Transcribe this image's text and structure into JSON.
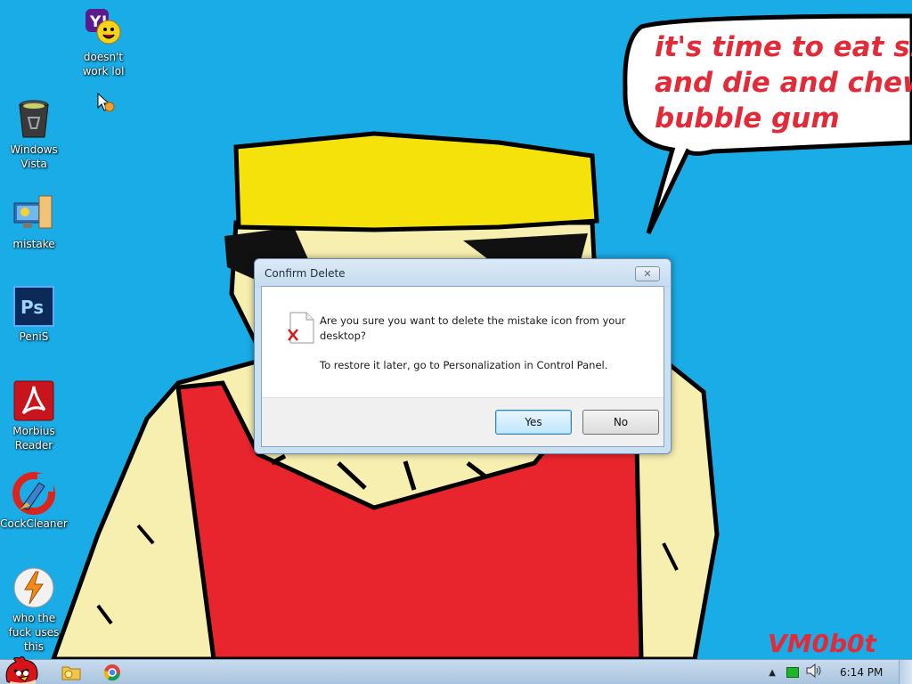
{
  "desktop": {
    "icons": [
      {
        "label": "doesn't work lol",
        "icon": "yahoo-messenger-icon"
      },
      {
        "label": "Windows Vista",
        "icon": "recycle-bin-icon"
      },
      {
        "label": "mistake",
        "icon": "personalization-icon"
      },
      {
        "label": "PeniS",
        "icon": "photoshop-icon"
      },
      {
        "label": "Morbius Reader",
        "icon": "adobe-reader-icon"
      },
      {
        "label": "CockCleaner",
        "icon": "ccleaner-icon"
      },
      {
        "label": "who the fuck uses this",
        "icon": "winamp-icon"
      }
    ]
  },
  "wallpaper": {
    "speech_bubble": [
      "it's time to eat shit",
      "and die and chew",
      "bubble gum"
    ],
    "signature": "VM0b0t",
    "colors": {
      "background": "#1aace6",
      "hat": "#f5e20a",
      "skin": "#f7efb0",
      "shirt": "#e8242c",
      "text_red": "#e22a38"
    }
  },
  "dialog": {
    "title": "Confirm Delete",
    "message": "Are you sure you want to delete the mistake icon from your desktop?",
    "hint": "To restore it later, go to Personalization in Control Panel.",
    "yes_label": "Yes",
    "no_label": "No"
  },
  "taskbar": {
    "start_icon": "angry-bird-start-icon",
    "pinned": [
      "explorer-folder-icon",
      "chrome-icon"
    ],
    "tray_icons": [
      "show-hidden-icons-icon",
      "network-icon",
      "volume-icon"
    ],
    "clock": "6:14 PM"
  }
}
